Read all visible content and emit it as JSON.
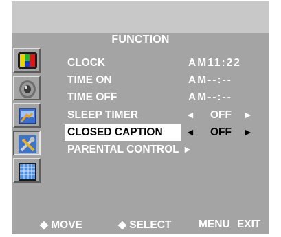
{
  "menu": {
    "title": "FUNCTION",
    "items": [
      {
        "label": "CLOCK",
        "value": "AM11:22"
      },
      {
        "label": "TIME ON",
        "value": "AM--:--"
      },
      {
        "label": "TIME OFF",
        "value": "AM--:--"
      },
      {
        "label": "SLEEP TIMER",
        "value": "OFF",
        "left_arrow": "◄",
        "right_arrow": "►"
      },
      {
        "label": "CLOSED CAPTION",
        "value": "OFF",
        "left_arrow": "◄",
        "right_arrow": "►",
        "selected": true
      },
      {
        "label": "PARENTAL CONTROL",
        "submenu_arrow": "►"
      }
    ]
  },
  "sidebar": {
    "icons": [
      {
        "name": "picture-icon"
      },
      {
        "name": "sound-icon"
      },
      {
        "name": "channel-icon"
      },
      {
        "name": "function-icon",
        "active": true
      },
      {
        "name": "pc-screen-icon"
      }
    ]
  },
  "footer": {
    "move": "◆ MOVE",
    "select": "◆ SELECT",
    "menu_exit": "MENU  EXIT"
  },
  "colors": {
    "panel": "#a4a4a4",
    "top_band": "#c8c8c8",
    "text": "#ffffff",
    "highlight": "#ffffff"
  }
}
